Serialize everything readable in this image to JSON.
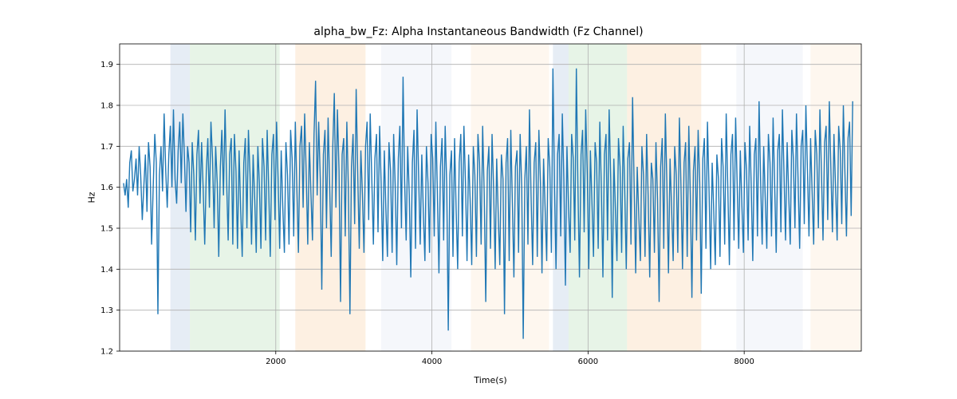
{
  "chart_data": {
    "type": "line",
    "title": "alpha_bw_Fz: Alpha Instantaneous Bandwidth (Fz Channel)",
    "xlabel": "Time(s)",
    "ylabel": "Hz",
    "xlim": [
      0,
      9500
    ],
    "ylim": [
      1.2,
      1.95
    ],
    "xticks": [
      2000,
      4000,
      6000,
      8000
    ],
    "yticks": [
      1.2,
      1.3,
      1.4,
      1.5,
      1.6,
      1.7,
      1.8,
      1.9
    ],
    "regions": [
      {
        "x0": 650,
        "x1": 900,
        "color": "blue"
      },
      {
        "x0": 900,
        "x1": 2050,
        "color": "green"
      },
      {
        "x0": 2250,
        "x1": 3150,
        "color": "orange"
      },
      {
        "x0": 3350,
        "x1": 4250,
        "color": "lilac"
      },
      {
        "x0": 4500,
        "x1": 5500,
        "color": "cream"
      },
      {
        "x0": 5550,
        "x1": 5750,
        "color": "blue"
      },
      {
        "x0": 5750,
        "x1": 6500,
        "color": "green"
      },
      {
        "x0": 6500,
        "x1": 7450,
        "color": "orange"
      },
      {
        "x0": 7900,
        "x1": 8750,
        "color": "lilac"
      },
      {
        "x0": 8850,
        "x1": 9500,
        "color": "cream"
      }
    ],
    "series": [
      {
        "name": "alpha_bw_Fz",
        "x_start": 50,
        "x_step": 20,
        "values": [
          1.61,
          1.58,
          1.62,
          1.55,
          1.66,
          1.69,
          1.59,
          1.62,
          1.67,
          1.58,
          1.7,
          1.63,
          1.52,
          1.6,
          1.68,
          1.54,
          1.71,
          1.65,
          1.46,
          1.6,
          1.73,
          1.66,
          1.29,
          1.63,
          1.7,
          1.59,
          1.78,
          1.64,
          1.55,
          1.68,
          1.75,
          1.6,
          1.79,
          1.62,
          1.56,
          1.69,
          1.76,
          1.61,
          1.78,
          1.67,
          1.54,
          1.7,
          1.66,
          1.49,
          1.71,
          1.63,
          1.47,
          1.68,
          1.74,
          1.56,
          1.71,
          1.6,
          1.46,
          1.64,
          1.72,
          1.55,
          1.76,
          1.67,
          1.5,
          1.7,
          1.61,
          1.43,
          1.65,
          1.74,
          1.58,
          1.79,
          1.62,
          1.47,
          1.68,
          1.72,
          1.46,
          1.73,
          1.64,
          1.45,
          1.69,
          1.55,
          1.43,
          1.66,
          1.72,
          1.5,
          1.74,
          1.63,
          1.46,
          1.68,
          1.57,
          1.44,
          1.7,
          1.61,
          1.45,
          1.72,
          1.65,
          1.47,
          1.74,
          1.59,
          1.43,
          1.68,
          1.73,
          1.52,
          1.76,
          1.62,
          1.45,
          1.69,
          1.55,
          1.44,
          1.71,
          1.63,
          1.46,
          1.74,
          1.67,
          1.48,
          1.76,
          1.6,
          1.44,
          1.7,
          1.75,
          1.55,
          1.78,
          1.63,
          1.46,
          1.71,
          1.59,
          1.47,
          1.73,
          1.86,
          1.58,
          1.76,
          1.62,
          1.35,
          1.68,
          1.74,
          1.5,
          1.77,
          1.61,
          1.43,
          1.7,
          1.83,
          1.55,
          1.79,
          1.64,
          1.32,
          1.68,
          1.72,
          1.48,
          1.76,
          1.6,
          1.29,
          1.65,
          1.73,
          1.51,
          1.84,
          1.63,
          1.45,
          1.69,
          1.58,
          1.44,
          1.7,
          1.76,
          1.52,
          1.78,
          1.62,
          1.46,
          1.67,
          1.73,
          1.49,
          1.75,
          1.61,
          1.42,
          1.69,
          1.55,
          1.43,
          1.71,
          1.64,
          1.44,
          1.73,
          1.6,
          1.41,
          1.67,
          1.75,
          1.5,
          1.87,
          1.62,
          1.47,
          1.7,
          1.58,
          1.38,
          1.66,
          1.74,
          1.45,
          1.79,
          1.63,
          1.46,
          1.68,
          1.54,
          1.42,
          1.7,
          1.61,
          1.44,
          1.73,
          1.67,
          1.48,
          1.76,
          1.59,
          1.39,
          1.65,
          1.72,
          1.47,
          1.75,
          1.6,
          1.25,
          1.63,
          1.69,
          1.43,
          1.72,
          1.55,
          1.4,
          1.66,
          1.73,
          1.48,
          1.75,
          1.61,
          1.42,
          1.68,
          1.57,
          1.41,
          1.7,
          1.63,
          1.43,
          1.73,
          1.66,
          1.46,
          1.75,
          1.58,
          1.32,
          1.64,
          1.7,
          1.45,
          1.73,
          1.6,
          1.4,
          1.67,
          1.53,
          1.41,
          1.68,
          1.62,
          1.29,
          1.66,
          1.72,
          1.42,
          1.74,
          1.57,
          1.38,
          1.65,
          1.69,
          1.44,
          1.73,
          1.6,
          1.23,
          1.62,
          1.7,
          1.46,
          1.79,
          1.58,
          1.41,
          1.66,
          1.71,
          1.43,
          1.74,
          1.61,
          1.39,
          1.67,
          1.55,
          1.42,
          1.72,
          1.65,
          1.44,
          1.89,
          1.6,
          1.4,
          1.68,
          1.73,
          1.48,
          1.78,
          1.62,
          1.36,
          1.7,
          1.55,
          1.44,
          1.73,
          1.67,
          1.47,
          1.89,
          1.61,
          1.38,
          1.68,
          1.74,
          1.49,
          1.79,
          1.63,
          1.4,
          1.69,
          1.56,
          1.43,
          1.71,
          1.66,
          1.45,
          1.76,
          1.6,
          1.38,
          1.68,
          1.73,
          1.47,
          1.79,
          1.62,
          1.33,
          1.67,
          1.55,
          1.42,
          1.72,
          1.65,
          1.44,
          1.75,
          1.59,
          1.4,
          1.67,
          1.71,
          1.46,
          1.82,
          1.61,
          1.39,
          1.65,
          1.53,
          1.42,
          1.7,
          1.63,
          1.43,
          1.73,
          1.58,
          1.38,
          1.66,
          1.62,
          1.44,
          1.71,
          1.57,
          1.32,
          1.65,
          1.72,
          1.45,
          1.78,
          1.61,
          1.39,
          1.67,
          1.55,
          1.42,
          1.7,
          1.63,
          1.44,
          1.77,
          1.6,
          1.4,
          1.66,
          1.71,
          1.43,
          1.75,
          1.58,
          1.33,
          1.64,
          1.7,
          1.47,
          1.74,
          1.61,
          1.34,
          1.67,
          1.72,
          1.45,
          1.76,
          1.59,
          1.4,
          1.66,
          1.54,
          1.41,
          1.68,
          1.62,
          1.43,
          1.72,
          1.65,
          1.46,
          1.78,
          1.6,
          1.41,
          1.68,
          1.73,
          1.47,
          1.77,
          1.61,
          1.45,
          1.69,
          1.56,
          1.44,
          1.71,
          1.64,
          1.47,
          1.75,
          1.6,
          1.42,
          1.68,
          1.72,
          1.48,
          1.81,
          1.62,
          1.46,
          1.7,
          1.57,
          1.45,
          1.73,
          1.66,
          1.48,
          1.77,
          1.61,
          1.44,
          1.69,
          1.73,
          1.49,
          1.79,
          1.63,
          1.47,
          1.71,
          1.58,
          1.46,
          1.74,
          1.67,
          1.5,
          1.78,
          1.62,
          1.45,
          1.7,
          1.74,
          1.51,
          1.8,
          1.64,
          1.48,
          1.72,
          1.59,
          1.46,
          1.74,
          1.68,
          1.5,
          1.79,
          1.63,
          1.47,
          1.71,
          1.75,
          1.52,
          1.81,
          1.65,
          1.49,
          1.73,
          1.6,
          1.47,
          1.75,
          1.69,
          1.51,
          1.8,
          1.64,
          1.48,
          1.72,
          1.76,
          1.53,
          1.81
        ]
      }
    ]
  },
  "colors": {
    "line": "#1f77b4",
    "grid": "#b0b0b0",
    "axis": "#000000"
  }
}
